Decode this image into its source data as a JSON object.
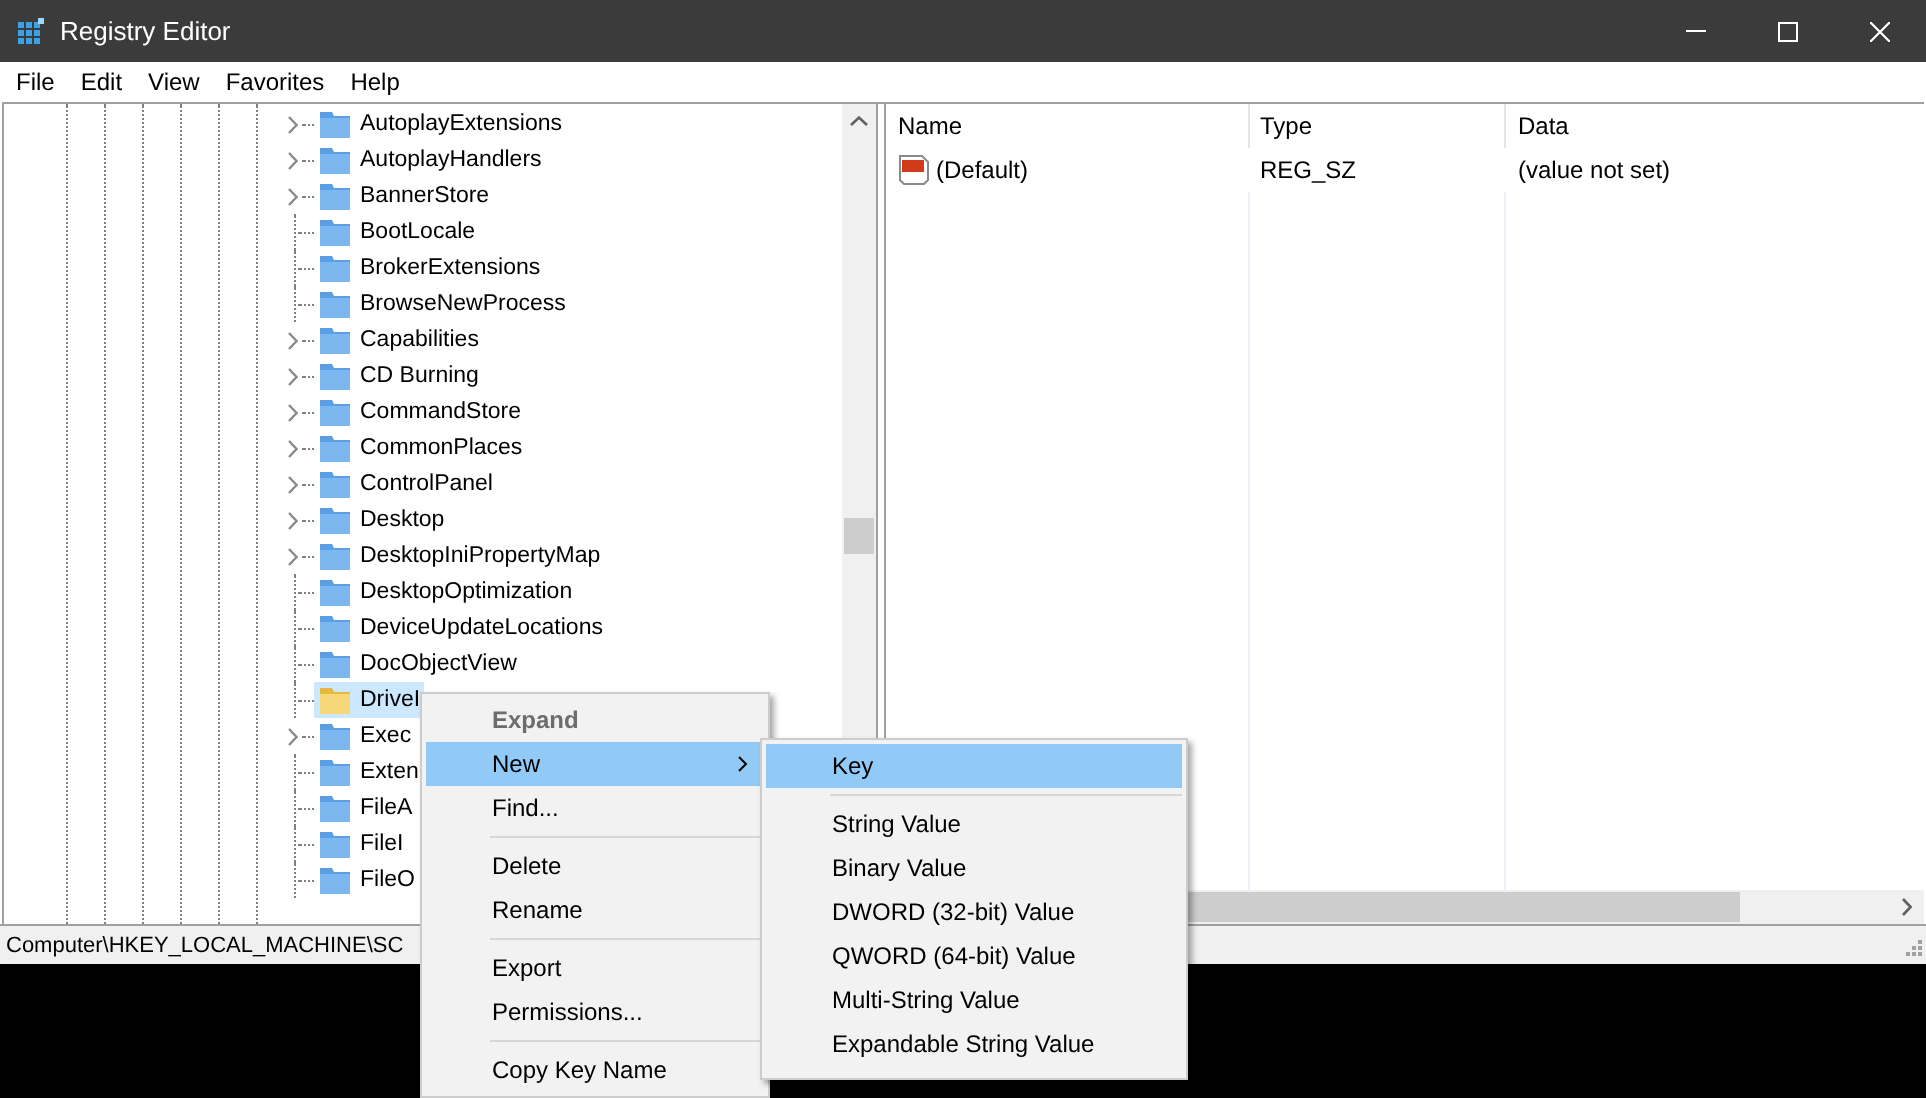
{
  "window": {
    "title": "Registry Editor"
  },
  "menu_bar": [
    "File",
    "Edit",
    "View",
    "Favorites",
    "Help"
  ],
  "tree": {
    "items": [
      {
        "label": "AutoplayExtensions",
        "expandable": true,
        "selected": false
      },
      {
        "label": "AutoplayHandlers",
        "expandable": true,
        "selected": false
      },
      {
        "label": "BannerStore",
        "expandable": true,
        "selected": false
      },
      {
        "label": "BootLocale",
        "expandable": false,
        "selected": false
      },
      {
        "label": "BrokerExtensions",
        "expandable": false,
        "selected": false
      },
      {
        "label": "BrowseNewProcess",
        "expandable": false,
        "selected": false
      },
      {
        "label": "Capabilities",
        "expandable": true,
        "selected": false
      },
      {
        "label": "CD Burning",
        "expandable": true,
        "selected": false
      },
      {
        "label": "CommandStore",
        "expandable": true,
        "selected": false
      },
      {
        "label": "CommonPlaces",
        "expandable": true,
        "selected": false
      },
      {
        "label": "ControlPanel",
        "expandable": true,
        "selected": false
      },
      {
        "label": "Desktop",
        "expandable": true,
        "selected": false
      },
      {
        "label": "DesktopIniPropertyMap",
        "expandable": true,
        "selected": false
      },
      {
        "label": "DesktopOptimization",
        "expandable": false,
        "selected": false
      },
      {
        "label": "DeviceUpdateLocations",
        "expandable": false,
        "selected": false
      },
      {
        "label": "DocObjectView",
        "expandable": false,
        "selected": false
      },
      {
        "label": "DriveI",
        "expandable": false,
        "selected": true
      },
      {
        "label": "Exec",
        "expandable": true,
        "selected": false
      },
      {
        "label": "Exten",
        "expandable": false,
        "selected": false
      },
      {
        "label": "FileA",
        "expandable": false,
        "selected": false
      },
      {
        "label": "FileI",
        "expandable": false,
        "selected": false
      },
      {
        "label": "FileO",
        "expandable": false,
        "selected": false
      }
    ]
  },
  "list": {
    "columns": [
      "Name",
      "Type",
      "Data"
    ],
    "rows": [
      {
        "name": "(Default)",
        "type": "REG_SZ",
        "data": "(value not set)"
      }
    ]
  },
  "status_bar": "Computer\\HKEY_LOCAL_MACHINE\\SC",
  "context_menu": {
    "items": [
      {
        "kind": "item",
        "label": "Expand",
        "disabled": true,
        "default": true,
        "selected": false,
        "submenu": false
      },
      {
        "kind": "item",
        "label": "New",
        "disabled": false,
        "default": false,
        "selected": true,
        "submenu": true
      },
      {
        "kind": "item",
        "label": "Find...",
        "disabled": false,
        "default": false,
        "selected": false,
        "submenu": false
      },
      {
        "kind": "separator"
      },
      {
        "kind": "item",
        "label": "Delete",
        "disabled": false,
        "default": false,
        "selected": false,
        "submenu": false
      },
      {
        "kind": "item",
        "label": "Rename",
        "disabled": false,
        "default": false,
        "selected": false,
        "submenu": false
      },
      {
        "kind": "separator"
      },
      {
        "kind": "item",
        "label": "Export",
        "disabled": false,
        "default": false,
        "selected": false,
        "submenu": false
      },
      {
        "kind": "item",
        "label": "Permissions...",
        "disabled": false,
        "default": false,
        "selected": false,
        "submenu": false
      },
      {
        "kind": "separator"
      },
      {
        "kind": "item",
        "label": "Copy Key Name",
        "disabled": false,
        "default": false,
        "selected": false,
        "submenu": false
      }
    ]
  },
  "submenu": {
    "items": [
      {
        "kind": "item",
        "label": "Key",
        "selected": true
      },
      {
        "kind": "separator"
      },
      {
        "kind": "item",
        "label": "String Value",
        "selected": false
      },
      {
        "kind": "item",
        "label": "Binary Value",
        "selected": false
      },
      {
        "kind": "item",
        "label": "DWORD (32-bit) Value",
        "selected": false
      },
      {
        "kind": "item",
        "label": "QWORD (64-bit) Value",
        "selected": false
      },
      {
        "kind": "item",
        "label": "Multi-String Value",
        "selected": false
      },
      {
        "kind": "item",
        "label": "Expandable String Value",
        "selected": false
      }
    ]
  }
}
